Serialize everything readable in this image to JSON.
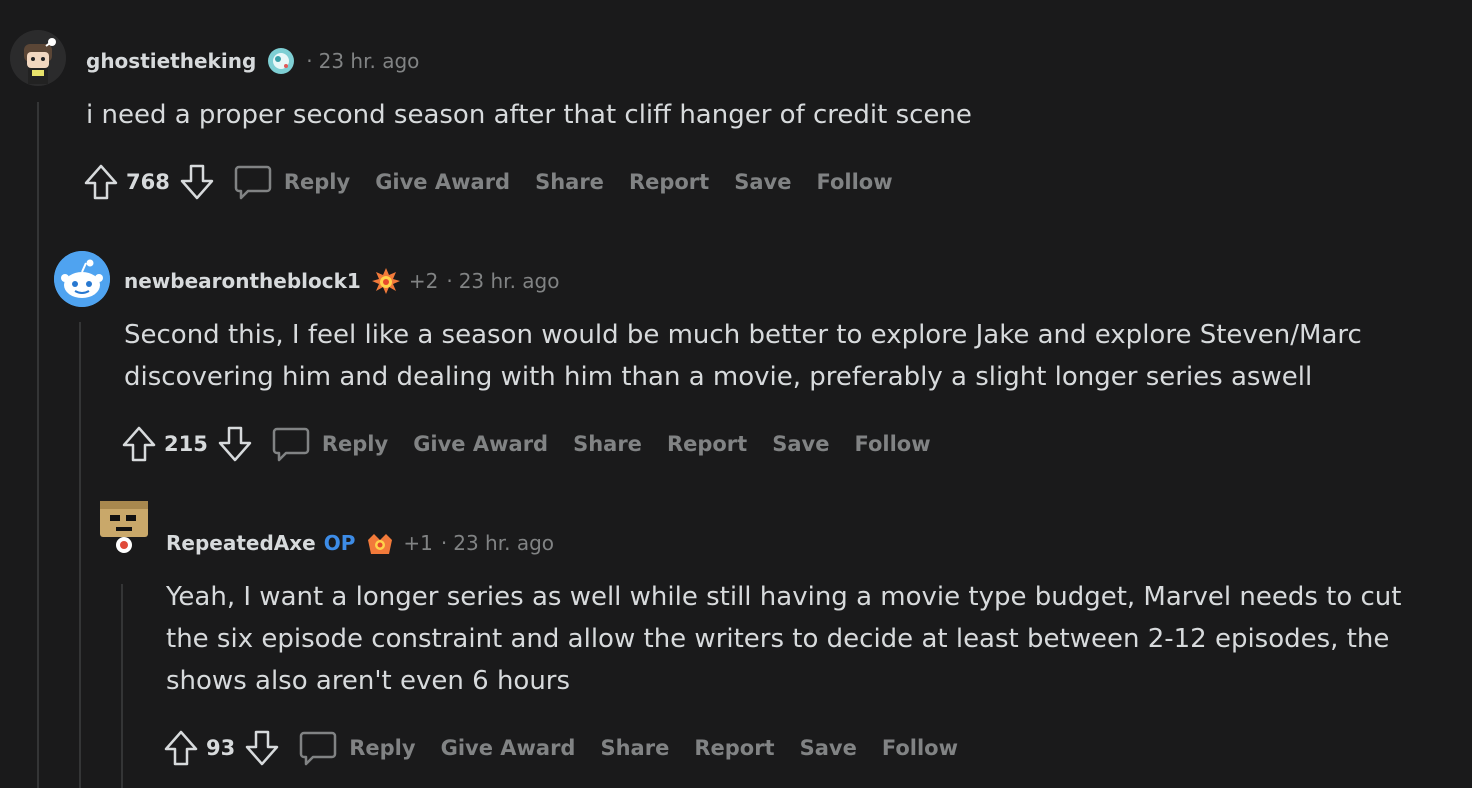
{
  "comments": [
    {
      "username": "ghostietheking",
      "separator": "·",
      "time": "23 hr. ago",
      "op_tag": "",
      "award_count": "",
      "flair_icon": "circle-bubble-icon",
      "body": "i need a proper second season after that cliff hanger of credit scene",
      "score": "768",
      "actions": {
        "reply": "Reply",
        "give_award": "Give Award",
        "share": "Share",
        "report": "Report",
        "save": "Save",
        "follow": "Follow"
      }
    },
    {
      "username": "newbearontheblock1",
      "separator": "·",
      "time": "23 hr. ago",
      "op_tag": "",
      "award_count": "+2",
      "flair_icon": "fire-award-icon",
      "body": "Second this, I feel like a season would be much better to explore Jake and explore Steven/Marc\ndiscovering him and dealing with him than a movie, preferably a slight longer series aswell",
      "score": "215",
      "actions": {
        "reply": "Reply",
        "give_award": "Give Award",
        "share": "Share",
        "report": "Report",
        "save": "Save",
        "follow": "Follow"
      }
    },
    {
      "username": "RepeatedAxe",
      "separator": "·",
      "time": "23 hr. ago",
      "op_tag": "OP",
      "award_count": "+1",
      "flair_icon": "crown-award-icon",
      "body": "Yeah, I want a longer series as well while still having a movie type budget, Marvel needs to cut\nthe six episode constraint and allow the writers to decide at least between 2-12 episodes, the\nshows also aren't even 6 hours",
      "score": "93",
      "actions": {
        "reply": "Reply",
        "give_award": "Give Award",
        "share": "Share",
        "report": "Report",
        "save": "Save",
        "follow": "Follow"
      }
    }
  ],
  "colors": {
    "background": "#1a1a1b",
    "text": "#d7dadc",
    "muted": "#818384",
    "op": "#3d8ce7",
    "thread_line": "#343536"
  }
}
